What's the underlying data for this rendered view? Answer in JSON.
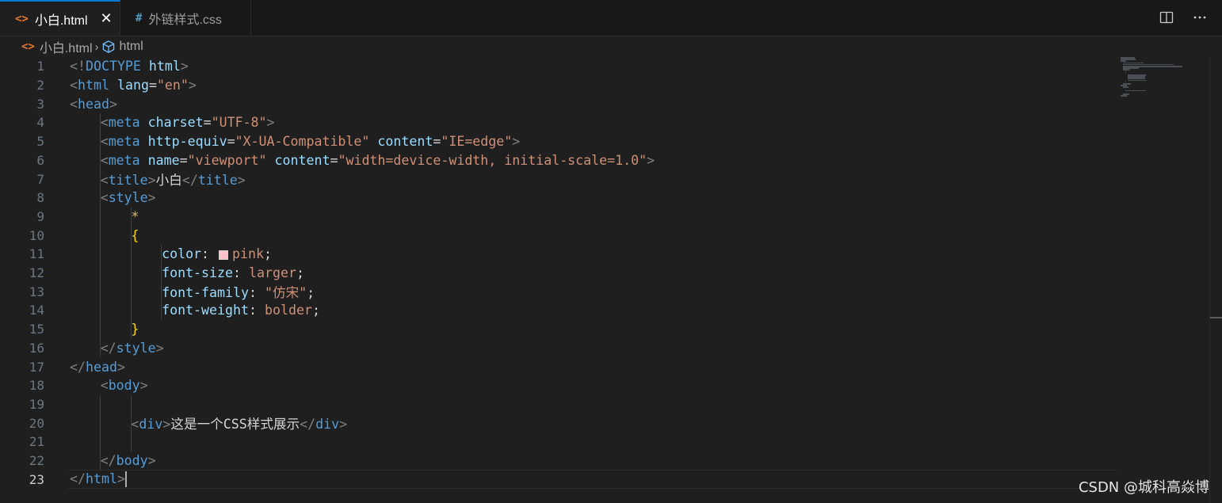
{
  "tabs": [
    {
      "label": "小白.html",
      "icon": "html-file-icon",
      "icon_glyph": "<>",
      "active": true
    },
    {
      "label": "外链样式.css",
      "icon": "css-file-icon",
      "icon_glyph": "#",
      "active": false
    }
  ],
  "tab_close_glyph": "✕",
  "breadcrumb": {
    "file": "小白.html",
    "file_icon_glyph": "<>",
    "separator": "›",
    "symbol": "html"
  },
  "editor": {
    "current_line": 23,
    "lines": [
      {
        "n": "1",
        "indent": 0,
        "tokens": [
          [
            "punct",
            "<!"
          ],
          [
            "tag",
            "DOCTYPE"
          ],
          [
            "plain",
            " "
          ],
          [
            "attr",
            "html"
          ],
          [
            "punct",
            ">"
          ]
        ]
      },
      {
        "n": "2",
        "indent": 0,
        "tokens": [
          [
            "punct",
            "<"
          ],
          [
            "tag",
            "html"
          ],
          [
            "plain",
            " "
          ],
          [
            "attr",
            "lang"
          ],
          [
            "plain",
            "="
          ],
          [
            "str",
            "\"en\""
          ],
          [
            "punct",
            ">"
          ]
        ]
      },
      {
        "n": "3",
        "indent": 0,
        "tokens": [
          [
            "punct",
            "<"
          ],
          [
            "tag",
            "head"
          ],
          [
            "punct",
            ">"
          ]
        ]
      },
      {
        "n": "4",
        "indent": 1,
        "tokens": [
          [
            "punct",
            "<"
          ],
          [
            "tag",
            "meta"
          ],
          [
            "plain",
            " "
          ],
          [
            "attr",
            "charset"
          ],
          [
            "plain",
            "="
          ],
          [
            "str",
            "\"UTF-8\""
          ],
          [
            "punct",
            ">"
          ]
        ]
      },
      {
        "n": "5",
        "indent": 1,
        "tokens": [
          [
            "punct",
            "<"
          ],
          [
            "tag",
            "meta"
          ],
          [
            "plain",
            " "
          ],
          [
            "attr",
            "http-equiv"
          ],
          [
            "plain",
            "="
          ],
          [
            "str",
            "\"X-UA-Compatible\""
          ],
          [
            "plain",
            " "
          ],
          [
            "attr",
            "content"
          ],
          [
            "plain",
            "="
          ],
          [
            "str",
            "\"IE=edge\""
          ],
          [
            "punct",
            ">"
          ]
        ]
      },
      {
        "n": "6",
        "indent": 1,
        "tokens": [
          [
            "punct",
            "<"
          ],
          [
            "tag",
            "meta"
          ],
          [
            "plain",
            " "
          ],
          [
            "attr",
            "name"
          ],
          [
            "plain",
            "="
          ],
          [
            "str",
            "\"viewport\""
          ],
          [
            "plain",
            " "
          ],
          [
            "attr",
            "content"
          ],
          [
            "plain",
            "="
          ],
          [
            "str",
            "\"width=device-width, initial-scale=1.0\""
          ],
          [
            "punct",
            ">"
          ]
        ]
      },
      {
        "n": "7",
        "indent": 1,
        "tokens": [
          [
            "punct",
            "<"
          ],
          [
            "tag",
            "title"
          ],
          [
            "punct",
            ">"
          ],
          [
            "text",
            "小白"
          ],
          [
            "punct",
            "</"
          ],
          [
            "tag",
            "title"
          ],
          [
            "punct",
            ">"
          ]
        ]
      },
      {
        "n": "8",
        "indent": 1,
        "tokens": [
          [
            "punct",
            "<"
          ],
          [
            "tag",
            "style"
          ],
          [
            "punct",
            ">"
          ]
        ]
      },
      {
        "n": "9",
        "indent": 2,
        "tokens": [
          [
            "sel",
            "*"
          ]
        ]
      },
      {
        "n": "10",
        "indent": 2,
        "tokens": [
          [
            "brace",
            "{"
          ]
        ]
      },
      {
        "n": "11",
        "indent": 3,
        "tokens": [
          [
            "prop",
            "color"
          ],
          [
            "plain",
            ": "
          ],
          [
            "swatch",
            "#ffc0cb"
          ],
          [
            "val",
            "pink"
          ],
          [
            "plain",
            ";"
          ]
        ]
      },
      {
        "n": "12",
        "indent": 3,
        "tokens": [
          [
            "prop",
            "font-size"
          ],
          [
            "plain",
            ": "
          ],
          [
            "val",
            "larger"
          ],
          [
            "plain",
            ";"
          ]
        ]
      },
      {
        "n": "13",
        "indent": 3,
        "tokens": [
          [
            "prop",
            "font-family"
          ],
          [
            "plain",
            ": "
          ],
          [
            "val",
            "\"仿宋\""
          ],
          [
            "plain",
            ";"
          ]
        ]
      },
      {
        "n": "14",
        "indent": 3,
        "tokens": [
          [
            "prop",
            "font-weight"
          ],
          [
            "plain",
            ": "
          ],
          [
            "val",
            "bolder"
          ],
          [
            "plain",
            ";"
          ]
        ]
      },
      {
        "n": "15",
        "indent": 2,
        "tokens": [
          [
            "brace",
            "}"
          ]
        ]
      },
      {
        "n": "16",
        "indent": 1,
        "tokens": [
          [
            "punct",
            "</"
          ],
          [
            "tag",
            "style"
          ],
          [
            "punct",
            ">"
          ]
        ]
      },
      {
        "n": "17",
        "indent": 0,
        "tokens": [
          [
            "punct",
            "</"
          ],
          [
            "tag",
            "head"
          ],
          [
            "punct",
            ">"
          ]
        ]
      },
      {
        "n": "18",
        "indent": 1,
        "tokens": [
          [
            "punct",
            "<"
          ],
          [
            "tag",
            "body"
          ],
          [
            "punct",
            ">"
          ]
        ]
      },
      {
        "n": "19",
        "indent": 0,
        "tokens": []
      },
      {
        "n": "20",
        "indent": 2,
        "tokens": [
          [
            "punct",
            "<"
          ],
          [
            "tag",
            "div"
          ],
          [
            "punct",
            ">"
          ],
          [
            "text",
            "这是一个CSS样式展示"
          ],
          [
            "punct",
            "</"
          ],
          [
            "tag",
            "div"
          ],
          [
            "punct",
            ">"
          ]
        ]
      },
      {
        "n": "21",
        "indent": 0,
        "tokens": []
      },
      {
        "n": "22",
        "indent": 1,
        "tokens": [
          [
            "punct",
            "</"
          ],
          [
            "tag",
            "body"
          ],
          [
            "punct",
            ">"
          ]
        ]
      },
      {
        "n": "23",
        "indent": 0,
        "tokens": [
          [
            "punct",
            "</"
          ],
          [
            "tag",
            "html"
          ],
          [
            "punct",
            ">"
          ],
          [
            "cursor",
            ""
          ]
        ]
      }
    ]
  },
  "watermark": "CSDN @城科高焱博"
}
